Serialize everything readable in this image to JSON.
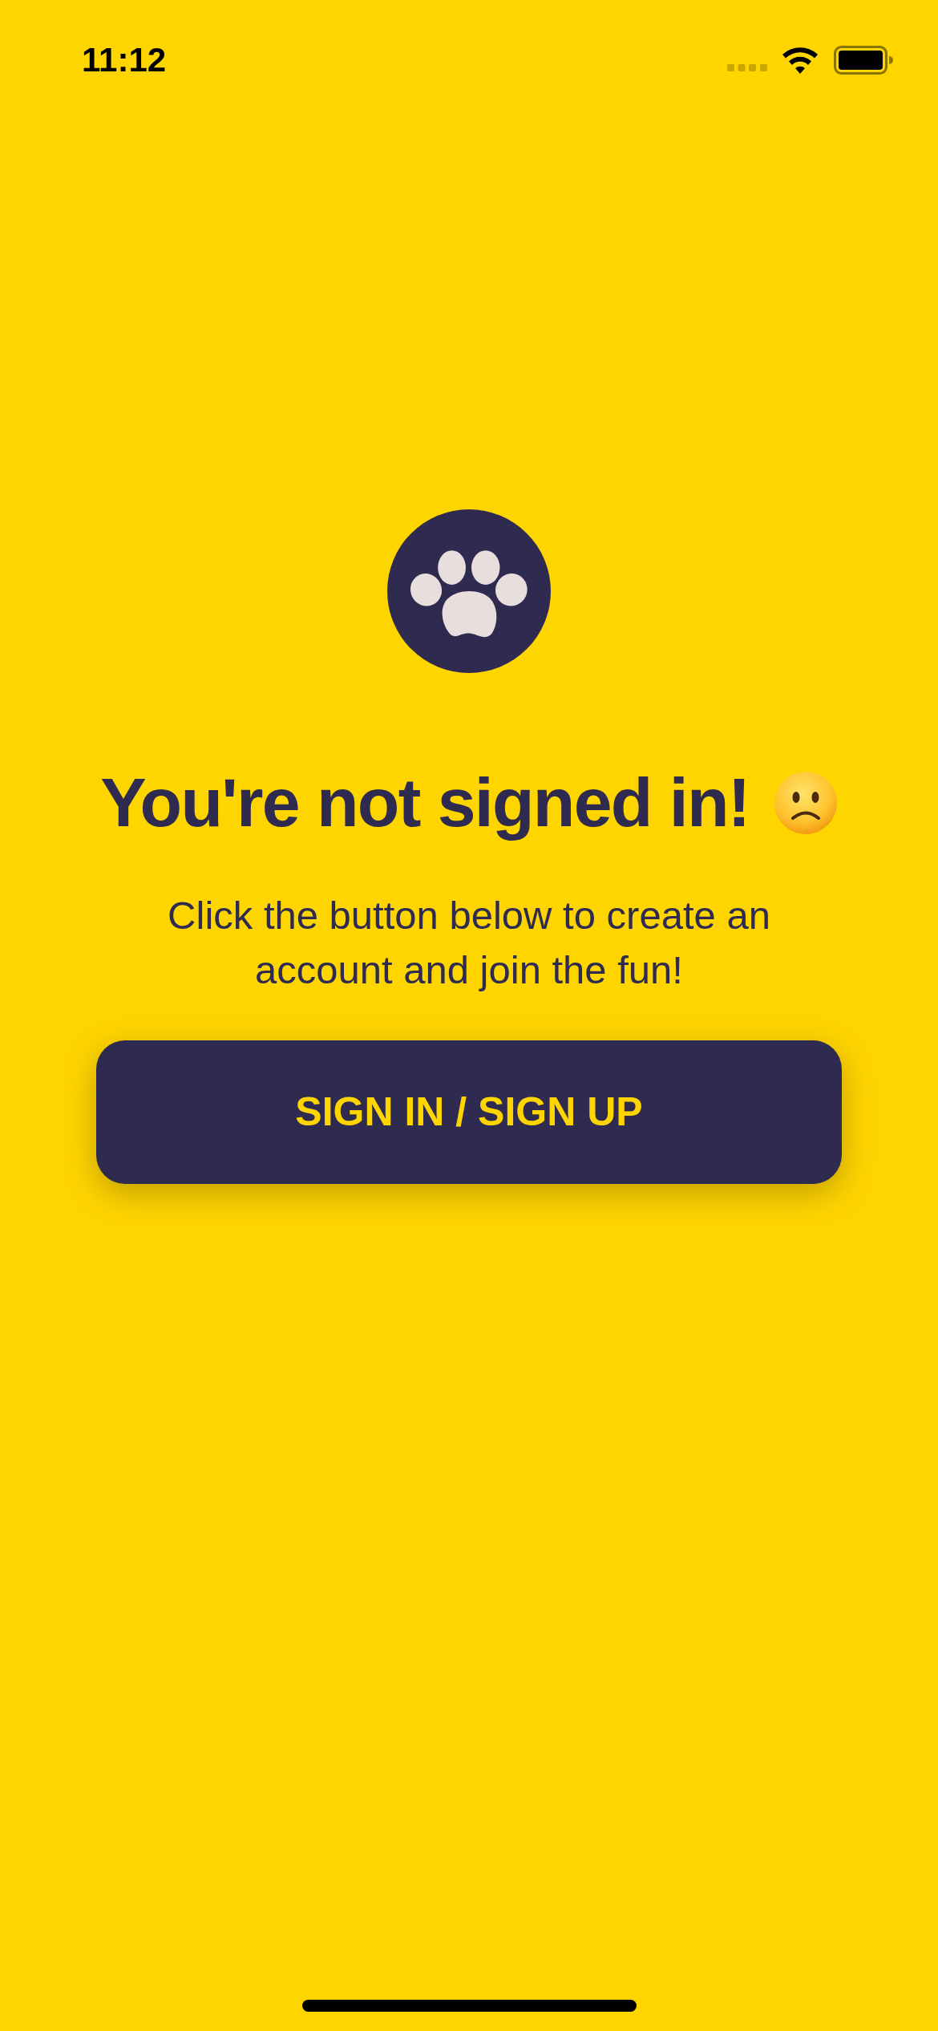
{
  "status_bar": {
    "time": "11:12"
  },
  "sign_in_prompt": {
    "title": "You're not signed in!",
    "message": "Click the button below to create an account and join the fun!",
    "button": "SIGN IN / SIGN UP"
  }
}
